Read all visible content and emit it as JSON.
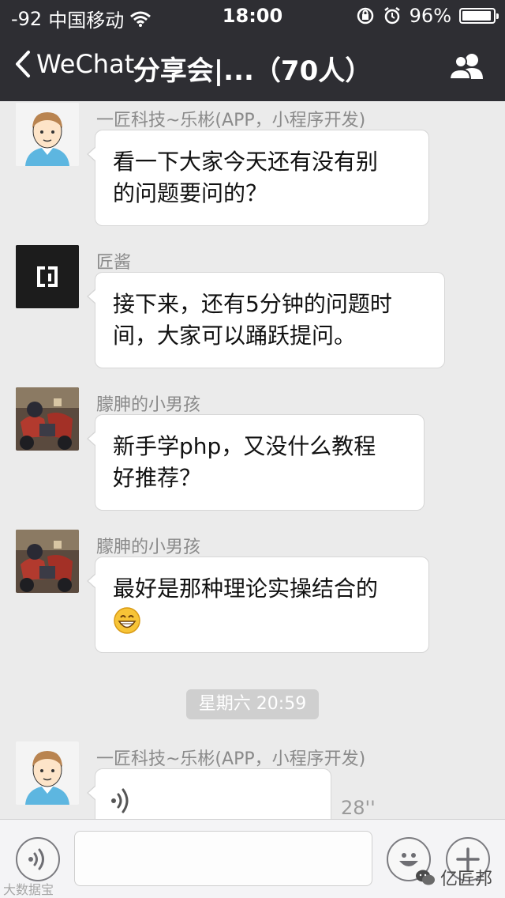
{
  "status_bar": {
    "signal": "-92",
    "carrier": "中国移动",
    "time": "18:00",
    "battery_percent": "96%",
    "battery_level": 0.96
  },
  "nav": {
    "back_label": "WeChat",
    "title": "分享会|...（70人）"
  },
  "messages": [
    {
      "sender": "一匠科技~乐彬(APP，小程序开发)",
      "lines": [
        "看一下大家今天还有没有别",
        "的问题要问的？"
      ]
    },
    {
      "sender": "匠酱",
      "lines": [
        "接下来，还有5分钟的问题时",
        "间，大家可以踊跃提问。"
      ]
    },
    {
      "sender": "朦胂的小男孩",
      "lines": [
        "新手学php，又没什么教程",
        "好推荐？"
      ]
    },
    {
      "sender": "朦胂的小男孩",
      "lines": [
        "最好是那种理论实操结合的"
      ]
    }
  ],
  "timestamp": "星期六 20:59",
  "voice_message": {
    "sender": "一匠科技~乐彬(APP，小程序开发)",
    "duration": "28''"
  },
  "watermarks": {
    "left": "大数据宝",
    "right": "亿匠邦"
  },
  "icons": {
    "back": "chevron-left-icon",
    "group": "group-members-icon",
    "wifi": "wifi-icon",
    "lock": "rotation-lock-icon",
    "alarm": "alarm-icon",
    "voice": "voice-icon",
    "emoji": "emoji-icon",
    "plus": "plus-icon"
  },
  "colors": {
    "nav_bg": "#2e2e33",
    "chat_bg": "#ebebeb",
    "bubble_bg": "#ffffff"
  }
}
